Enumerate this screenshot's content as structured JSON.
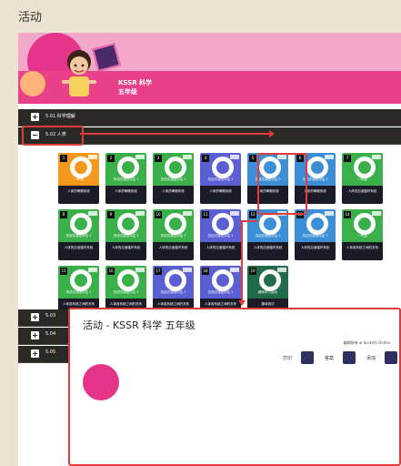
{
  "page_title": "活动",
  "banner": {
    "subject": "KSSR 科学",
    "grade": "五年级"
  },
  "sections": [
    {
      "label": "5.01 科学理解",
      "expanded": false
    },
    {
      "label": "5.02 人类",
      "expanded": true
    },
    {
      "label": "5.03",
      "expanded": false
    },
    {
      "label": "5.04",
      "expanded": false
    },
    {
      "label": "5.05",
      "expanded": false
    }
  ],
  "cards": [
    {
      "num": "1",
      "color": "#f39a1e",
      "icon": "document-icon",
      "title": "一年级",
      "caption": "人体的骨骼系统"
    },
    {
      "num": "2",
      "color": "#3bb04a",
      "icon": "blocked-icon",
      "title": "形成式课堂评估 1",
      "caption": "人体的骨骼系统"
    },
    {
      "num": "3",
      "color": "#3bb04a",
      "icon": "blocked-icon",
      "title": "形成式课堂评估 1",
      "caption": "人体的骨骼系统"
    },
    {
      "num": "4",
      "color": "#5a5fd1",
      "icon": "document-icon",
      "title": "总结式课堂评估 1",
      "caption": "人体的骨骼系统"
    },
    {
      "num": "5",
      "color": "#3c8fd6",
      "icon": "document-icon",
      "title": "总结式课堂评估 2",
      "caption": "人体的骨骼系统"
    },
    {
      "num": "6",
      "color": "#3c8fd6",
      "icon": "document-icon",
      "title": "总结式课堂评估 3",
      "caption": "人体的骨骼系统"
    },
    {
      "num": "7",
      "color": "#3bb04a",
      "icon": "document-icon",
      "title": "一年级",
      "caption": "人体的血液循环系统"
    },
    {
      "num": "8",
      "color": "#3bb04a",
      "icon": "blocked-icon",
      "title": "形成式课堂评估 1",
      "caption": "人体的血液循环系统"
    },
    {
      "num": "9",
      "color": "#3bb04a",
      "icon": "blocked-icon",
      "title": "形成式课堂评估 2",
      "caption": "人体的血液循环系统"
    },
    {
      "num": "10",
      "color": "#3bb04a",
      "icon": "blocked-icon",
      "title": "形成式课堂评估 3",
      "caption": "人体的血液循环系统"
    },
    {
      "num": "11",
      "color": "#5a5fd1",
      "icon": "document-icon",
      "title": "总结式课堂评估 1",
      "caption": "人体的血液循环系统"
    },
    {
      "num": "12",
      "color": "#3c8fd6",
      "icon": "document-icon",
      "title": "总结式课堂评估 2",
      "caption": "人体的血液循环系统"
    },
    {
      "num": "13",
      "color": "#3c8fd6",
      "icon": "document-icon",
      "title": "总结式课堂评估 3",
      "caption": "人体的血液循环系统"
    },
    {
      "num": "14",
      "color": "#3bb04a",
      "icon": "document-icon",
      "title": "一年级",
      "caption": "人体各系统之间的关系"
    },
    {
      "num": "15",
      "color": "#3bb04a",
      "icon": "blocked-icon",
      "title": "形成式课堂评估 1",
      "caption": "人体各系统之间的关系"
    },
    {
      "num": "16",
      "color": "#3bb04a",
      "icon": "blocked-icon",
      "title": "形成式课堂评估 2",
      "caption": "人体各系统之间的关系"
    },
    {
      "num": "17",
      "color": "#5a5fd1",
      "icon": "document-icon",
      "title": "总结式课堂评估 1",
      "caption": "人体各系统之间的关系"
    },
    {
      "num": "18",
      "color": "#5a5fd1",
      "icon": "document-icon",
      "title": "总结式课堂评估 2",
      "caption": "人体各系统之间的关系"
    },
    {
      "num": "19",
      "color": "#1f6b4a",
      "icon": "lightbulb-icon",
      "title": "趣味学习活动",
      "caption": "趣味测试"
    }
  ],
  "inset": {
    "title": "活动 - KSSR 科学 五年级",
    "breadcrumb": "编辑所有 ⊕ Scratch Online",
    "buttons": [
      {
        "label": "打印",
        "icon": "print-icon",
        "color": "#2e3160"
      },
      {
        "label": "答案",
        "icon": "answer-icon",
        "color": "#2e3160"
      },
      {
        "label": "添加",
        "icon": "add-icon",
        "color": "#2e3160"
      }
    ]
  }
}
